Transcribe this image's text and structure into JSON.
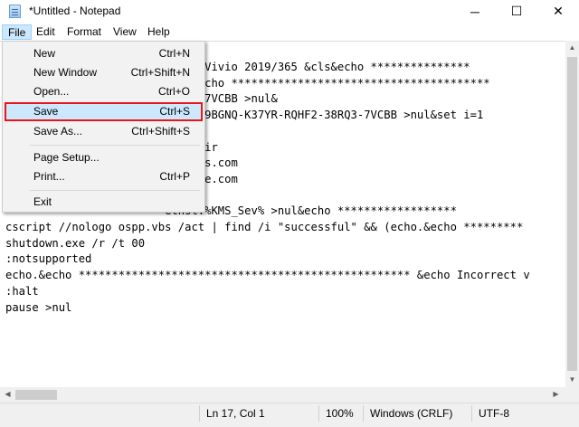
{
  "window": {
    "title": "*Untitled - Notepad",
    "minimize": "─",
    "maximize": "☐",
    "close": "✕"
  },
  "menubar": {
    "items": [
      "File",
      "Edit",
      "Format",
      "View",
      "Help"
    ]
  },
  "file_menu": {
    "items": [
      {
        "label": "New",
        "shortcut": "Ctrl+N"
      },
      {
        "label": "New Window",
        "shortcut": "Ctrl+Shift+N"
      },
      {
        "label": "Open...",
        "shortcut": "Ctrl+O"
      },
      {
        "label": "Save",
        "shortcut": "Ctrl+S"
      },
      {
        "label": "Save As...",
        "shortcut": "Ctrl+Shift+S"
      },
      {
        "label": "Page Setup...",
        "shortcut": ""
      },
      {
        "label": "Print...",
        "shortcut": "Ctrl+P"
      },
      {
        "label": "Exit",
        "shortcut": ""
      }
    ],
    "highlighted": "Save"
  },
  "editor": {
    "visible_lines": [
      "                        osoft Vivio 2019/365 &cls&echo ***************",
      "                        cho.&echo ***************************************",
      "                        npkey:7VCBB >nul&",
      "                        npkey:9BGNQ-K37YR-RQHF2-38RQ3-7VCBB >nul&set i=1",
      "",
      "                        giboy.ir",
      "                        SGuides.com",
      "                        inancce.com",
      "",
      "                        ethst:%KMS_Sev% >nul&echo ******************",
      "cscript //nologo ospp.vbs /act | find /i \"successful\" && (echo.&echo *********",
      "shutdown.exe /r /t 00",
      ":notsupported",
      "echo.&echo ************************************************** &echo Incorrect v",
      ":halt",
      "pause >nul"
    ]
  },
  "statusbar": {
    "position": "Ln 17, Col 1",
    "zoom": "100%",
    "line_endings": "Windows (CRLF)",
    "encoding": "UTF-8"
  }
}
